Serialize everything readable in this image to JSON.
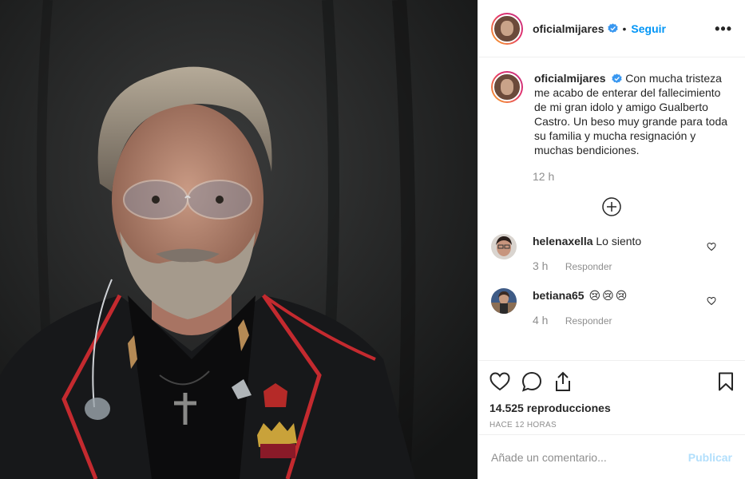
{
  "post": {
    "username": "oficialmijares",
    "verified": true,
    "follow_label": "Seguir",
    "more_label": "•••",
    "separator": "•"
  },
  "caption": {
    "username": "oficialmijares",
    "text": "Con mucha tristeza me acabo de enterar del fallecimiento de mi gran idolo y amigo Gualberto Castro. Un beso muy grande para toda su familia y mucha resignación y muchas bendiciones.",
    "time": "12 h"
  },
  "comments": [
    {
      "username": "helenaxella",
      "text": "Lo siento",
      "time": "3 h",
      "reply_label": "Responder"
    },
    {
      "username": "betiana65",
      "text": "",
      "emoji": [
        "😢",
        "😢",
        "😢"
      ],
      "time": "4 h",
      "reply_label": "Responder"
    }
  ],
  "stats": {
    "views": "14.525 reproducciones",
    "posted": "HACE 12 HORAS"
  },
  "add_comment": {
    "placeholder": "Añade un comentario...",
    "publish_label": "Publicar"
  },
  "icons": {
    "like": "heart-icon",
    "comment": "comment-icon",
    "share": "share-icon",
    "save": "bookmark-icon",
    "load_more": "plus-circle-icon",
    "verified": "verified-badge-icon"
  },
  "colors": {
    "link_blue": "#0095f6",
    "publish_disabled": "#b2dffc",
    "muted": "#8e8e8e",
    "text": "#262626",
    "verified": "#3897f0"
  }
}
